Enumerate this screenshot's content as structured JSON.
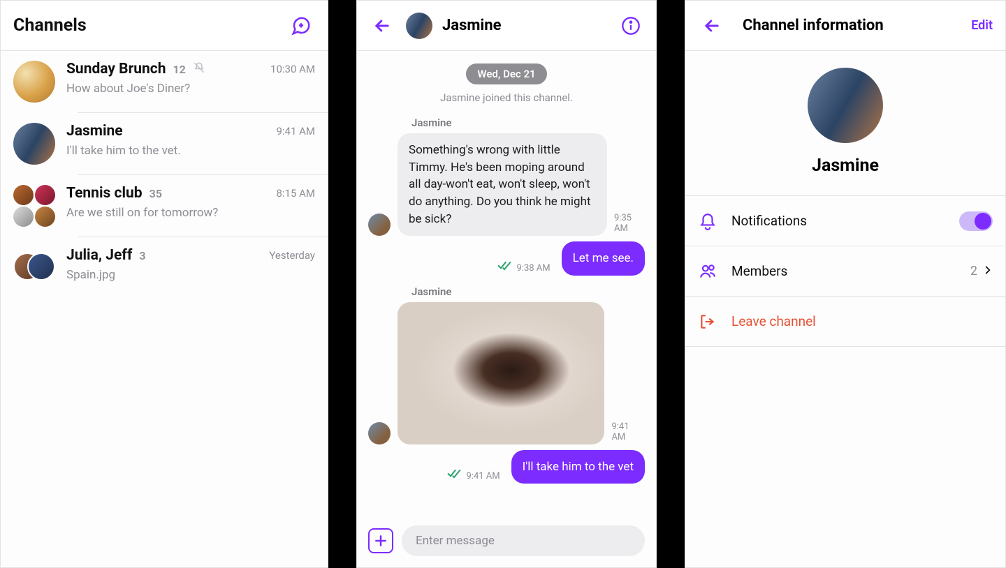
{
  "accent": "#7c2cff",
  "channels_screen": {
    "title": "Channels",
    "items": [
      {
        "name": "Sunday Brunch",
        "count": "12",
        "muted": true,
        "time": "10:30 AM",
        "preview": "How about Joe's Diner?",
        "avatar": "brunch"
      },
      {
        "name": "Jasmine",
        "count": "",
        "muted": false,
        "time": "9:41 AM",
        "preview": "I'll take him to the vet.",
        "avatar": "jasmine"
      },
      {
        "name": "Tennis club",
        "count": "35",
        "muted": false,
        "time": "8:15 AM",
        "preview": "Are we still on for tomorrow?",
        "avatar": "group4"
      },
      {
        "name": "Julia, Jeff",
        "count": "3",
        "muted": false,
        "time": "Yesterday",
        "preview": "Spain.jpg",
        "avatar": "dual"
      }
    ]
  },
  "chat_screen": {
    "title": "Jasmine",
    "date_chip": "Wed, Dec 21",
    "system": "Jasmine joined this channel.",
    "messages": [
      {
        "dir": "in",
        "sender": "Jasmine",
        "text": "Something's wrong with little Timmy. He's been moping around all day-won't eat, won't sleep, won't do anything. Do you think he might be sick?",
        "time": "9:35 AM"
      },
      {
        "dir": "out",
        "text": "Let me see.",
        "time": "9:38 AM",
        "read": true
      },
      {
        "dir": "in",
        "sender": "Jasmine",
        "type": "image",
        "time": "9:41 AM"
      },
      {
        "dir": "out",
        "text": "I'll take him to the vet",
        "time": "9:41 AM",
        "read": true
      }
    ],
    "compose_placeholder": "Enter message"
  },
  "info_screen": {
    "title": "Channel information",
    "edit": "Edit",
    "name": "Jasmine",
    "rows": {
      "notifications": {
        "label": "Notifications",
        "on": true
      },
      "members": {
        "label": "Members",
        "count": "2"
      },
      "leave": {
        "label": "Leave channel"
      }
    }
  }
}
